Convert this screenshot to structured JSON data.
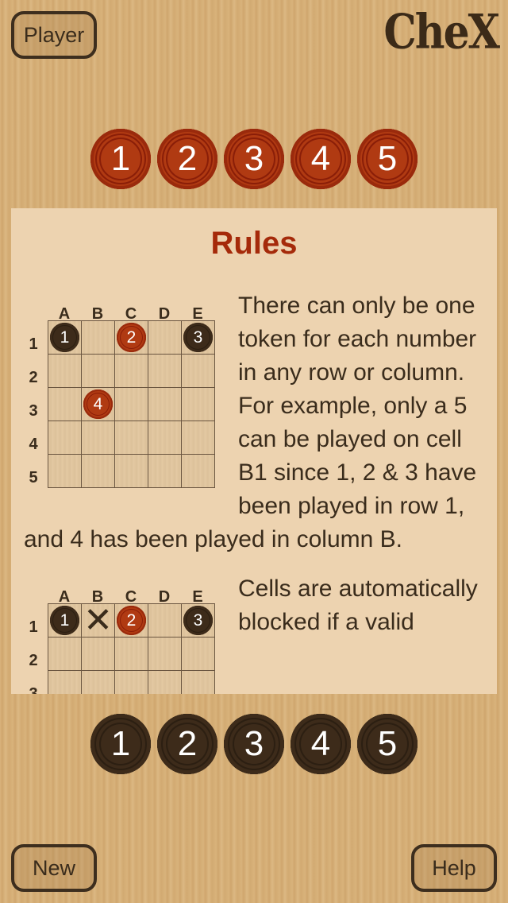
{
  "header": {
    "player_label": "Player",
    "logo": "CheX"
  },
  "player_tokens": [
    "1",
    "2",
    "3",
    "4",
    "5"
  ],
  "opponent_tokens": [
    "1",
    "2",
    "3",
    "4",
    "5"
  ],
  "colors": {
    "red_token": "#b03a12",
    "dark_token": "#3d2b1a",
    "title": "#a52a0a",
    "panel": "#edd3b0"
  },
  "rules": {
    "title": "Rules",
    "columns": [
      "A",
      "B",
      "C",
      "D",
      "E"
    ],
    "rows": [
      "1",
      "2",
      "3",
      "4",
      "5"
    ],
    "sections": [
      {
        "text": "There can only be one token for each number in any row or column. For example, only a 5 can be played on cell B1 since 1, 2 & 3 have been played in row 1, and 4 has been played in column B.",
        "cells": [
          {
            "col": 0,
            "row": 0,
            "value": "1",
            "color": "dark"
          },
          {
            "col": 2,
            "row": 0,
            "value": "2",
            "color": "red"
          },
          {
            "col": 4,
            "row": 0,
            "value": "3",
            "color": "dark"
          },
          {
            "col": 1,
            "row": 2,
            "value": "4",
            "color": "red"
          }
        ]
      },
      {
        "text": "Cells are automatically blocked if a valid",
        "cells": [
          {
            "col": 0,
            "row": 0,
            "value": "1",
            "color": "dark"
          },
          {
            "col": 1,
            "row": 0,
            "value": "X",
            "color": "blocked"
          },
          {
            "col": 2,
            "row": 0,
            "value": "2",
            "color": "red"
          },
          {
            "col": 4,
            "row": 0,
            "value": "3",
            "color": "dark"
          }
        ]
      }
    ]
  },
  "footer": {
    "new_label": "New",
    "help_label": "Help"
  }
}
